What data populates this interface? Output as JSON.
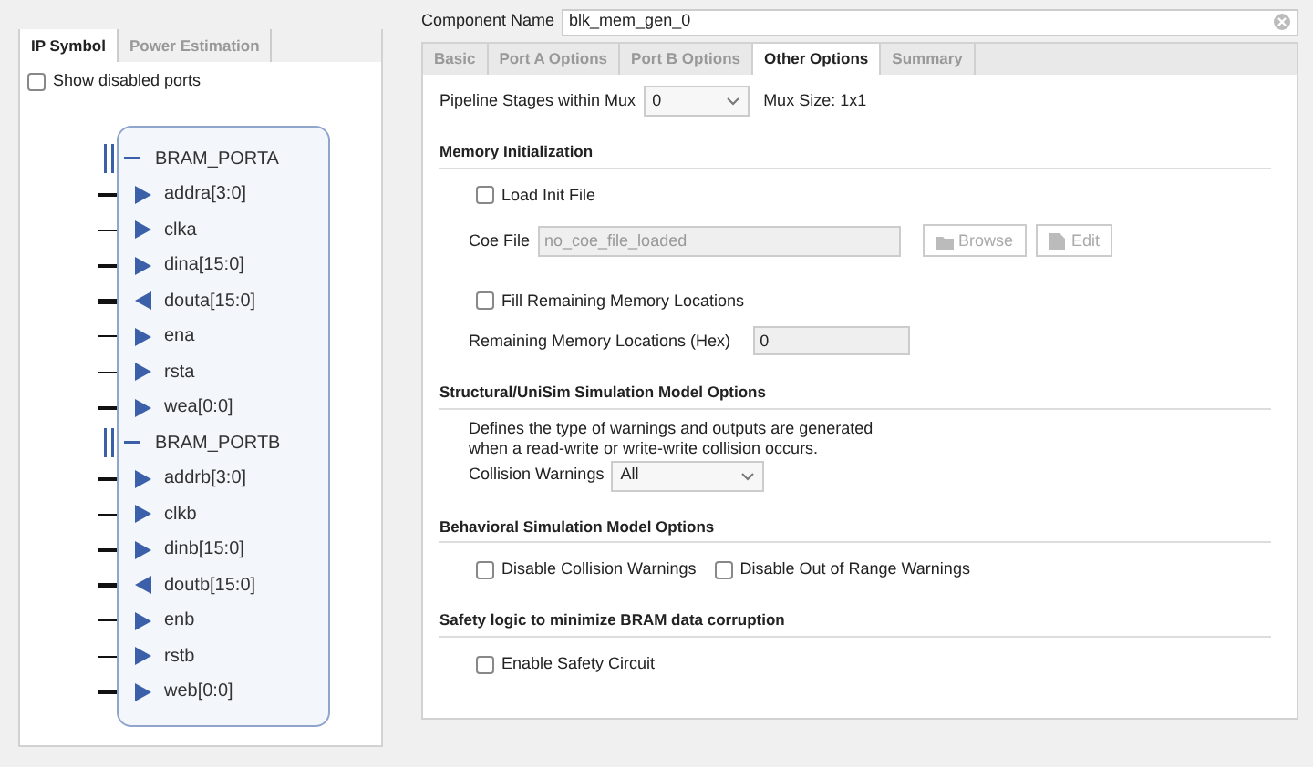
{
  "left_panel": {
    "tabs": [
      {
        "label": "IP Symbol",
        "selected": true
      },
      {
        "label": "Power Estimation",
        "selected": false
      }
    ],
    "show_disabled_ports": {
      "label": "Show disabled ports",
      "checked": false
    },
    "interfaces": [
      {
        "name": "BRAM_PORTA",
        "pins": [
          {
            "name": "addra[3:0]",
            "kind": "input",
            "bus": true
          },
          {
            "name": "clka",
            "kind": "input",
            "bus": false
          },
          {
            "name": "dina[15:0]",
            "kind": "input",
            "bus": true
          },
          {
            "name": "douta[15:0]",
            "kind": "output",
            "bus": true
          },
          {
            "name": "ena",
            "kind": "input",
            "bus": false
          },
          {
            "name": "rsta",
            "kind": "input",
            "bus": false
          },
          {
            "name": "wea[0:0]",
            "kind": "input",
            "bus": true
          }
        ]
      },
      {
        "name": "BRAM_PORTB",
        "pins": [
          {
            "name": "addrb[3:0]",
            "kind": "input",
            "bus": true
          },
          {
            "name": "clkb",
            "kind": "input",
            "bus": false
          },
          {
            "name": "dinb[15:0]",
            "kind": "input",
            "bus": true
          },
          {
            "name": "doutb[15:0]",
            "kind": "output",
            "bus": true
          },
          {
            "name": "enb",
            "kind": "input",
            "bus": false
          },
          {
            "name": "rstb",
            "kind": "input",
            "bus": false
          },
          {
            "name": "web[0:0]",
            "kind": "input",
            "bus": true
          }
        ]
      }
    ]
  },
  "component_name": {
    "label": "Component Name",
    "value": "blk_mem_gen_0"
  },
  "tabs": [
    {
      "label": "Basic",
      "selected": false
    },
    {
      "label": "Port A Options",
      "selected": false
    },
    {
      "label": "Port B Options",
      "selected": false
    },
    {
      "label": "Other Options",
      "selected": true
    },
    {
      "label": "Summary",
      "selected": false
    }
  ],
  "sections": [
    {
      "items": [
        {
          "kind": "select",
          "label": "Pipeline Stages within Mux",
          "value": "0",
          "note": "Mux Size: 1x1"
        }
      ]
    },
    {
      "title": "Memory Initialization",
      "items": [
        {
          "kind": "checkbox",
          "label": "Load Init File",
          "checked": false
        },
        {
          "kind": "file",
          "label": "Coe File",
          "value": "no_coe_file_loaded",
          "buttons": [
            "Browse",
            "Edit"
          ]
        },
        {
          "kind": "checkbox",
          "label": "Fill Remaining Memory Locations",
          "checked": false
        },
        {
          "kind": "text",
          "label": "Remaining Memory Locations (Hex)",
          "value": "0",
          "disabled": true
        }
      ]
    },
    {
      "title": "Structural/UniSim Simulation Model Options",
      "items": [
        {
          "kind": "note",
          "text": "Defines the type of warnings and outputs are generated when a read-write or write-write collision occurs."
        },
        {
          "kind": "select",
          "label": "Collision Warnings",
          "value": "All"
        }
      ]
    },
    {
      "title": "Behavioral Simulation Model Options",
      "items": [
        {
          "kind": "checkbox_row",
          "boxes": [
            {
              "label": "Disable Collision Warnings",
              "checked": false
            },
            {
              "label": "Disable Out of Range Warnings",
              "checked": false
            }
          ]
        }
      ]
    },
    {
      "title": "Safety logic to minimize BRAM data corruption",
      "items": [
        {
          "kind": "checkbox",
          "label": "Enable Safety Circuit",
          "checked": false
        }
      ]
    }
  ]
}
